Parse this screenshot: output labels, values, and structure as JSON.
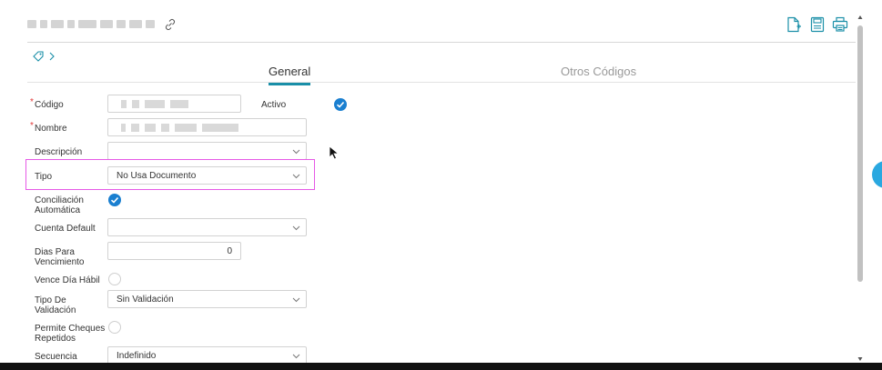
{
  "tabs": {
    "general": "General",
    "otros": "Otros Códigos"
  },
  "form": {
    "codigo": {
      "label": "Código",
      "required": "*"
    },
    "activo": {
      "label": "Activo"
    },
    "nombre": {
      "label": "Nombre",
      "required": "*"
    },
    "descripcion": {
      "label": "Descripción",
      "value": ""
    },
    "tipo": {
      "label": "Tipo",
      "value": "No Usa Documento"
    },
    "conciliacion": {
      "label1": "Conciliación",
      "label2": "Automática"
    },
    "cuenta_default": {
      "label": "Cuenta Default",
      "value": ""
    },
    "dias": {
      "label1": "Dias Para",
      "label2": "Vencimiento",
      "value": "0"
    },
    "vence": {
      "label": "Vence Día Hábil"
    },
    "tipo_validacion": {
      "label1": "Tipo De",
      "label2": "Validación",
      "value": "Sin Validación"
    },
    "permite": {
      "label1": "Permite Cheques",
      "label2": "Repetidos"
    },
    "secuencia": {
      "label": "Secuencia",
      "value": "Indefinido"
    }
  },
  "icons": {
    "header": [
      "link-icon",
      "new-document-icon",
      "save-icon",
      "print-icon"
    ],
    "tag": "tag-icon",
    "chevron": "chevron-down-icon"
  },
  "colors": {
    "accent": "#1a8fa8",
    "check": "#1a7fd0",
    "required": "#e23b3b",
    "highlight": "#e659e6"
  }
}
